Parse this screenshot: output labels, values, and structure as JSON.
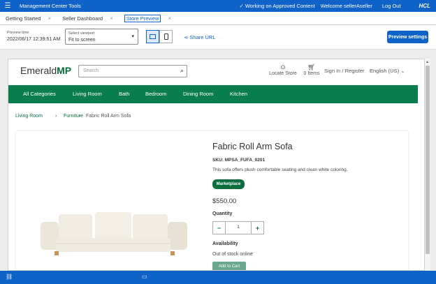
{
  "topbar": {
    "title": "Management Center Tools",
    "working_on": "✓ Working on Approved Content",
    "welcome": "Welcome sellerAseller",
    "logout": "Log Out",
    "brand": "HCL"
  },
  "tabs": [
    {
      "label": "Getting Started"
    },
    {
      "label": "Seller Dashboard"
    },
    {
      "label": "Store Preview",
      "active": true
    }
  ],
  "toolbar": {
    "preview_time_label": "Preview time",
    "preview_time_value": "2022/06/17 12:39:51 AM",
    "viewport_label": "Select viewport",
    "viewport_value": "Fit to screen",
    "share_label": "Share URL",
    "preview_settings_label": "Preview settings"
  },
  "store": {
    "logo_prefix": "Emerald",
    "logo_suffix": "MP",
    "search_placeholder": "Search",
    "locate_store": "Locate Store",
    "cart_count": "0 Items",
    "sign_in": "Sign In / Register",
    "language": "English (US)",
    "nav": [
      "All Categories",
      "Living Room",
      "Bath",
      "Bedroom",
      "Dining Room",
      "Kitchen"
    ],
    "breadcrumb": [
      "Living Room",
      "Furniture",
      "Fabric Roll Arm Sofa"
    ]
  },
  "product": {
    "name": "Fabric Roll Arm Sofa",
    "sku": "SKU: MPSA_FUFA_0201",
    "description": "This sofa offers plush comfortable seating and clean white coloring.",
    "badge": "Marketplace",
    "price": "$550.00",
    "quantity_label": "Quantity",
    "quantity_value": "1",
    "availability_label": "Availability",
    "availability_value": "Out of stock online",
    "add_to_cart": "Add to Cart"
  },
  "colors": {
    "primary_blue": "#0f62c7",
    "store_green": "#0a7d4e"
  }
}
